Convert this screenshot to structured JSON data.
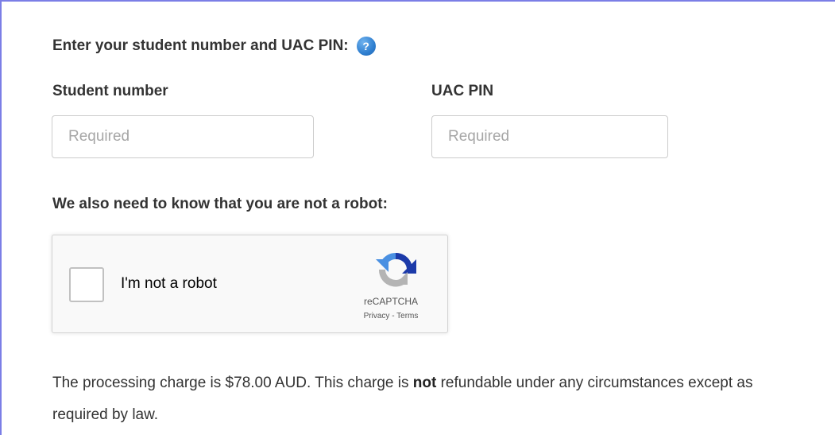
{
  "form": {
    "heading": "Enter your student number and UAC PIN:",
    "help_icon_glyph": "?",
    "student_number": {
      "label": "Student number",
      "placeholder": "Required",
      "value": ""
    },
    "uac_pin": {
      "label": "UAC PIN",
      "placeholder": "Required",
      "value": ""
    }
  },
  "captcha": {
    "heading": "We also need to know that you are not a robot:",
    "checkbox_label": "I'm not a robot",
    "checked": false,
    "brand": "reCAPTCHA",
    "privacy_link": "Privacy",
    "separator": "-",
    "terms_link": "Terms",
    "icon": "recaptcha-logo-icon"
  },
  "notice": {
    "text_before": "The processing charge is $78.00 AUD. This charge is ",
    "emphasis": "not",
    "text_after": " refundable under any circumstances except as required by law."
  },
  "colors": {
    "frame_border": "#7b7ee6",
    "help_icon": "#2f7fd0",
    "recaptcha_blue": "#1c3aa9",
    "recaptcha_light_blue": "#4a90e2",
    "recaptcha_grey": "#b4b4b4"
  }
}
